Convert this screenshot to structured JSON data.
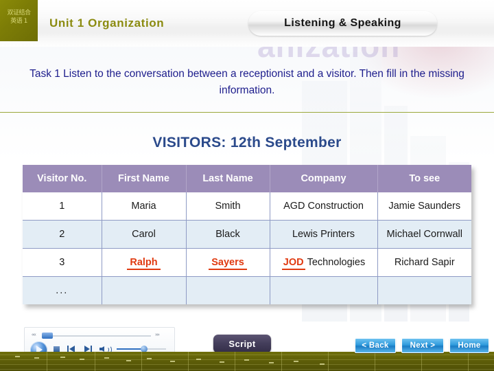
{
  "header": {
    "logo_line1": "双证结合",
    "logo_line2": "英语 1",
    "unit_title": "Unit 1  Organization",
    "section_pill": "Listening & Speaking",
    "watermark": "anization"
  },
  "instruction": {
    "text": "Task 1 Listen to the conversation between a receptionist and a visitor. Then fill in the missing information."
  },
  "table": {
    "title": "VISITORS: 12th September",
    "columns": [
      "Visitor No.",
      "First Name",
      "Last Name",
      "Company",
      "To see"
    ],
    "rows": [
      {
        "no": "1",
        "first_name": "Maria",
        "last_name": "Smith",
        "company": "AGD Construction",
        "to_see": "Jamie Saunders",
        "answers": []
      },
      {
        "no": "2",
        "first_name": "Carol",
        "last_name": "Black",
        "company": "Lewis Printers",
        "to_see": "Michael Cornwall",
        "answers": []
      },
      {
        "no": "3",
        "first_name": "Ralph",
        "last_name": "Sayers",
        "company_answer": "JOD",
        "company_rest": "Technologies",
        "to_see": "Richard Sapir",
        "answers": [
          "Ralph",
          "Sayers",
          "JOD"
        ]
      },
      {
        "no": "...",
        "first_name": "",
        "last_name": "",
        "company": "",
        "to_see": "",
        "answers": []
      }
    ]
  },
  "player": {
    "play_label": "play-button",
    "stop_label": "stop-button",
    "prev_label": "previous-button",
    "next_label": "next-button",
    "volume_label": "volume-icon",
    "seek_left_mark": "««",
    "seek_right_mark": "»»"
  },
  "buttons": {
    "script": "Script",
    "back": "< Back",
    "next": "Next >",
    "home": "Home"
  },
  "colors": {
    "olive": "#6f6f0a",
    "table_header_purple": "#9b8cb8",
    "answer_red": "#e03a10",
    "instruction_navy": "#1d1d8c",
    "title_blue": "#2b4a8b",
    "nav_blue": "#2f9bdd"
  }
}
